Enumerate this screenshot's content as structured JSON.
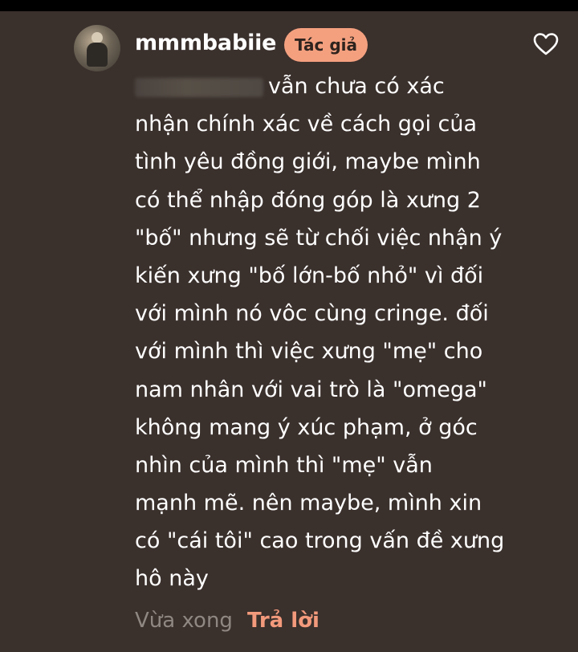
{
  "comment": {
    "username": "mmmbabiie",
    "author_badge": "Tác giả",
    "lines": [
      "vẫn chưa có xác",
      "nhận chính xác về cách gọi của",
      "tình yêu đồng giới, maybe mình",
      "có thể nhập đóng góp là xưng 2",
      "\"bố\" nhưng sẽ từ chối việc nhận ý",
      "kiến xưng \"bố lớn-bố nhỏ\" vì đối",
      "với mình nó vôc cùng cringe. đối",
      "với mình thì việc xưng \"mẹ\" cho",
      "nam nhân với vai trò là \"omega\"",
      "không mang ý xúc phạm, ở góc",
      "nhìn của mình thì \"mẹ\" vẫn",
      "mạnh mẽ. nên maybe, mình xin",
      "có \"cái tôi\" cao trong vấn đề xưng",
      "hô này"
    ],
    "timestamp": "Vừa xong",
    "reply_label": "Trả lời"
  },
  "icons": {
    "like": "heart-outline-icon"
  },
  "colors": {
    "background": "#3a302c",
    "badge": "#f4a07f",
    "reply": "#f39a7c",
    "timestamp": "#8f8782"
  }
}
